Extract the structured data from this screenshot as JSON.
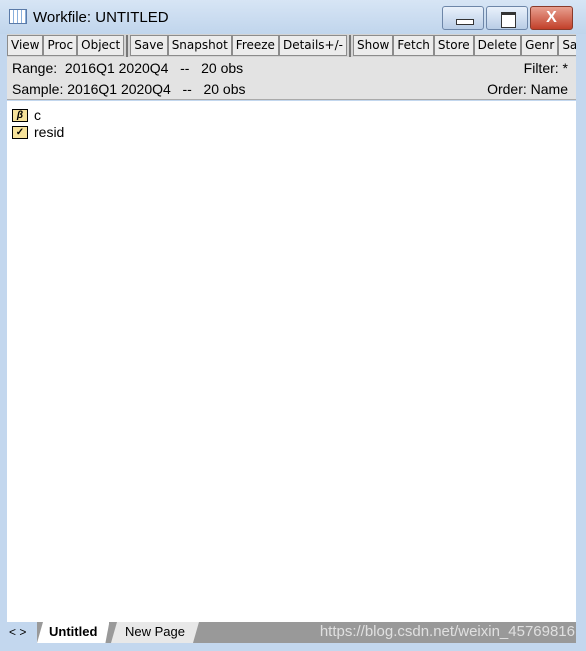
{
  "window": {
    "title": "Workfile: UNTITLED",
    "close_label": "X"
  },
  "toolbar": {
    "buttons": [
      "View",
      "Proc",
      "Object",
      "Save",
      "Snapshot",
      "Freeze",
      "Details+/-",
      "Show",
      "Fetch",
      "Store",
      "Delete",
      "Genr",
      "Sample"
    ]
  },
  "info": {
    "range": "Range:  2016Q1 2020Q4   --   20 obs",
    "sample": "Sample: 2016Q1 2020Q4   --   20 obs",
    "filter": "Filter: *",
    "order": "Order: Name"
  },
  "objects": [
    {
      "name": "c",
      "icon": "coefficient-beta-icon",
      "glyph": "β"
    },
    {
      "name": "resid",
      "icon": "series-icon",
      "glyph": "✓"
    }
  ],
  "tabs": {
    "nav": "< >",
    "pages": [
      "Untitled",
      "New Page"
    ]
  },
  "watermark": "https://blog.csdn.net/weixin_45769816"
}
